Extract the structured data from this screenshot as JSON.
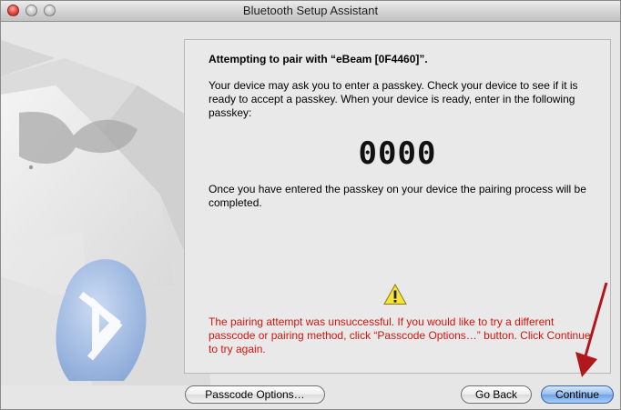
{
  "window": {
    "title": "Bluetooth Setup Assistant"
  },
  "panel": {
    "title": "Attempting to pair with “eBeam [0F4460]”.",
    "instructions": "Your device may ask you to enter a passkey. Check your device to see if it is ready to accept a passkey. When your device is ready, enter in the following passkey:",
    "passkey": "0000",
    "completion": "Once you have entered the passkey on your device the pairing process will be completed.",
    "error": "The pairing attempt was unsuccessful. If you would like to try a different passcode or pairing method, click “Passcode Options…” button. Click Continue to try again.",
    "warning_icon": "warning-triangle-icon"
  },
  "buttons": {
    "passcode_options": "Passcode Options…",
    "go_back": "Go Back",
    "continue": "Continue"
  },
  "colors": {
    "error_text": "#d3150e",
    "default_button": "#6ea3e6",
    "annotation_arrow": "#b0181b"
  }
}
